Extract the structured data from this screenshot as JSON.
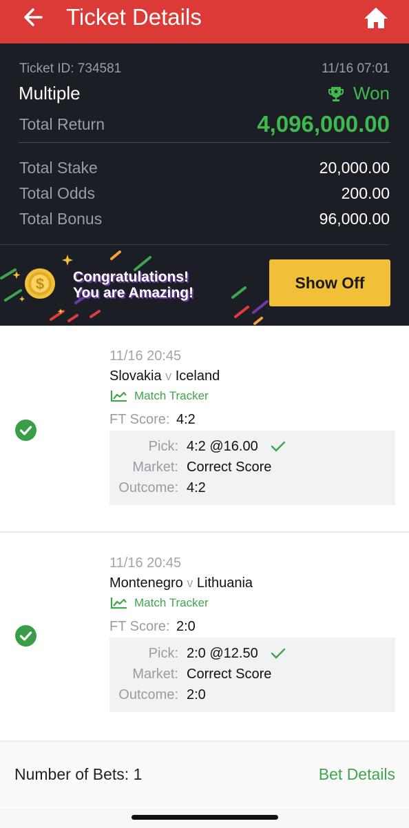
{
  "header": {
    "title": "Ticket Details",
    "back_icon": "arrow-left-icon",
    "home_icon": "home-icon",
    "color": "#dc3a37"
  },
  "summary": {
    "ticket_id": "Ticket ID: 734581",
    "datetime": "11/16 07:01",
    "bet_type": "Multiple",
    "status": "Won",
    "status_icon": "trophy-icon",
    "total_return_label": "Total Return",
    "total_return_value": "4,096,000.00",
    "rows": [
      {
        "label": "Total Stake",
        "value": "20,000.00"
      },
      {
        "label": "Total Odds",
        "value": "200.00"
      },
      {
        "label": "Total Bonus",
        "value": "96,000.00"
      }
    ],
    "accent_green": "#3fb94d"
  },
  "banner": {
    "line1": "Congratulations!",
    "line2": "You are Amazing!",
    "coin_icon": "dollar-coin-icon",
    "button_label": "Show Off",
    "button_color": "#f2c038"
  },
  "bets": [
    {
      "status_icon": "check-circle-icon",
      "date": "11/16 20:45",
      "home": "Slovakia",
      "vs": "v",
      "away": "Iceland",
      "tracker_label": "Match Tracker",
      "ft_label": "FT Score:",
      "ft_value": "4:2",
      "pick_label": "Pick:",
      "pick_value": "4:2 @16.00",
      "market_label": "Market:",
      "market_value": "Correct Score",
      "outcome_label": "Outcome:",
      "outcome_value": "4:2"
    },
    {
      "status_icon": "check-circle-icon",
      "date": "11/16 20:45",
      "home": "Montenegro",
      "vs": "v",
      "away": "Lithuania",
      "tracker_label": "Match Tracker",
      "ft_label": "FT Score:",
      "ft_value": "2:0",
      "pick_label": "Pick:",
      "pick_value": "2:0 @12.50",
      "market_label": "Market:",
      "market_value": "Correct Score",
      "outcome_label": "Outcome:",
      "outcome_value": "2:0"
    }
  ],
  "footer": {
    "number_of_bets": "Number of Bets: 1",
    "bet_details": "Bet Details"
  }
}
